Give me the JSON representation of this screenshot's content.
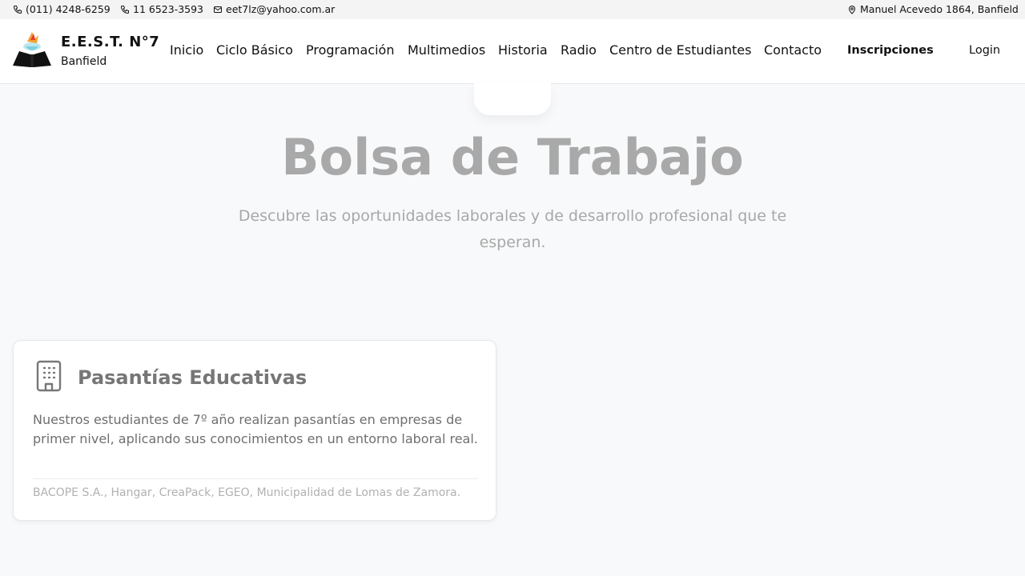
{
  "topbar": {
    "phone1": "(011) 4248-6259",
    "phone2": "11 6523-3593",
    "email": "eet7lz@yahoo.com.ar",
    "address": "Manuel Acevedo 1864, Banfield"
  },
  "brand": {
    "title": "E.E.S.T. N°7",
    "subtitle": "Banfield"
  },
  "nav": {
    "items": [
      "Inicio",
      "Ciclo Básico",
      "Programación",
      "Multimedios",
      "Historia",
      "Radio",
      "Centro de Estudiantes",
      "Contacto"
    ],
    "cta": "Inscripciones",
    "login": "Login"
  },
  "hero": {
    "title": "Bolsa de Trabajo",
    "subtitle": "Descubre las oportunidades laborales y de desarrollo profesional que te esperan."
  },
  "card": {
    "icon": "building-icon",
    "title": "Pasantías Educativas",
    "body": "Nuestros estudiantes de 7º año realizan pasantías en empresas de primer nivel, aplicando sus conocimientos en un entorno laboral real.",
    "footer": "BACOPE S.A., Hangar, CreaPack, EGEO, Municipalidad de Lomas de Zamora."
  },
  "colors": {
    "background": "#f8f9fa",
    "title_gray": "#a9a9a9",
    "text_dark": "#111111"
  }
}
